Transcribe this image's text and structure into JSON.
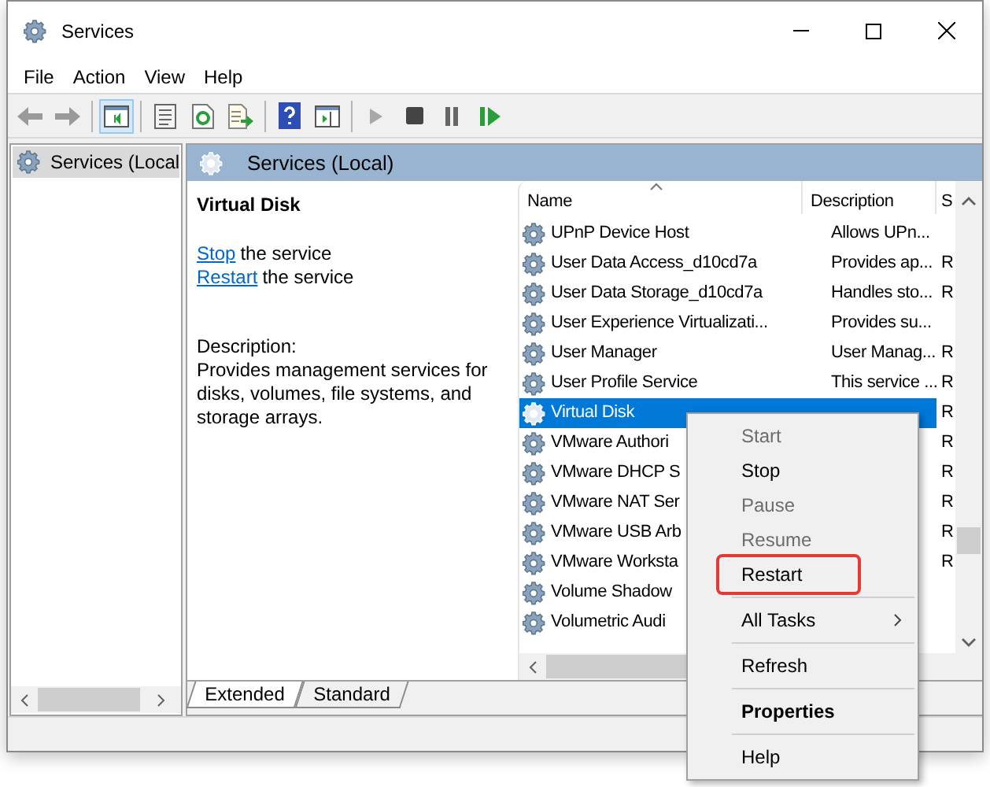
{
  "window": {
    "title": "Services"
  },
  "menu_bar": [
    "File",
    "Action",
    "View",
    "Help"
  ],
  "toolbar": [
    {
      "kind": "back",
      "disabled": true
    },
    {
      "kind": "forward",
      "disabled": true
    },
    {
      "kind": "separator"
    },
    {
      "kind": "tree",
      "pressed": true
    },
    {
      "kind": "separator"
    },
    {
      "kind": "properties"
    },
    {
      "kind": "refresh"
    },
    {
      "kind": "export"
    },
    {
      "kind": "separator"
    },
    {
      "kind": "help"
    },
    {
      "kind": "pane"
    },
    {
      "kind": "separator"
    },
    {
      "kind": "start",
      "disabled": true
    },
    {
      "kind": "stop"
    },
    {
      "kind": "pause"
    },
    {
      "kind": "restart"
    }
  ],
  "tree": {
    "items": [
      {
        "label": "Services (Local",
        "selected": true
      }
    ]
  },
  "header": {
    "title": "Services (Local)"
  },
  "details": {
    "title": "Virtual Disk",
    "actions": [
      {
        "link": "Stop",
        "text": "the service"
      },
      {
        "link": "Restart",
        "text": "the service"
      }
    ],
    "description_label": "Description:",
    "description": "Provides management services for disks, volumes, file systems, and storage arrays."
  },
  "table": {
    "columns": [
      "Name",
      "Description",
      "S"
    ],
    "rows": [
      {
        "name": "UPnP Device Host",
        "description": "Allows UPn...",
        "status": "",
        "selected": false
      },
      {
        "name": "User Data Access_d10cd7a",
        "description": "Provides ap...",
        "status": "R",
        "selected": false
      },
      {
        "name": "User Data Storage_d10cd7a",
        "description": "Handles sto...",
        "status": "R",
        "selected": false
      },
      {
        "name": "User Experience Virtualizati...",
        "description": "Provides su...",
        "status": "",
        "selected": false
      },
      {
        "name": "User Manager",
        "description": "User Manag...",
        "status": "R",
        "selected": false
      },
      {
        "name": "User Profile Service",
        "description": "This service ...",
        "status": "R",
        "selected": false
      },
      {
        "name": "Virtual Disk",
        "description": "",
        "status": "R",
        "selected": true
      },
      {
        "name": "VMware Authori",
        "description": "",
        "status": "R",
        "selected": false
      },
      {
        "name": "VMware DHCP S",
        "description": "",
        "status": "R",
        "selected": false
      },
      {
        "name": "VMware NAT Ser",
        "description": "",
        "status": "R",
        "selected": false
      },
      {
        "name": "VMware USB Arb",
        "description": "",
        "status": "R",
        "selected": false
      },
      {
        "name": "VMware Worksta",
        "description": "",
        "status": "R",
        "selected": false
      },
      {
        "name": "Volume Shadow",
        "description": "",
        "status": "",
        "selected": false
      },
      {
        "name": "Volumetric Audi",
        "description": "",
        "status": "",
        "selected": false
      }
    ]
  },
  "tabs": [
    {
      "label": "Extended",
      "selected": true
    },
    {
      "label": "Standard",
      "selected": false
    }
  ],
  "context_menu": [
    {
      "kind": "item",
      "label": "Start",
      "disabled": true,
      "bold": false,
      "submenu": false,
      "outlined": false
    },
    {
      "kind": "item",
      "label": "Stop",
      "disabled": false,
      "bold": false,
      "submenu": false,
      "outlined": false
    },
    {
      "kind": "item",
      "label": "Pause",
      "disabled": true,
      "bold": false,
      "submenu": false,
      "outlined": false
    },
    {
      "kind": "item",
      "label": "Resume",
      "disabled": true,
      "bold": false,
      "submenu": false,
      "outlined": false
    },
    {
      "kind": "item",
      "label": "Restart",
      "disabled": false,
      "bold": false,
      "submenu": false,
      "outlined": true
    },
    {
      "kind": "separator"
    },
    {
      "kind": "item",
      "label": "All Tasks",
      "disabled": false,
      "bold": false,
      "submenu": true,
      "outlined": false
    },
    {
      "kind": "separator"
    },
    {
      "kind": "item",
      "label": "Refresh",
      "disabled": false,
      "bold": false,
      "submenu": false,
      "outlined": false
    },
    {
      "kind": "separator"
    },
    {
      "kind": "item",
      "label": "Properties",
      "disabled": false,
      "bold": true,
      "submenu": false,
      "outlined": false
    },
    {
      "kind": "separator"
    },
    {
      "kind": "item",
      "label": "Help",
      "disabled": false,
      "bold": false,
      "submenu": false,
      "outlined": false
    }
  ]
}
